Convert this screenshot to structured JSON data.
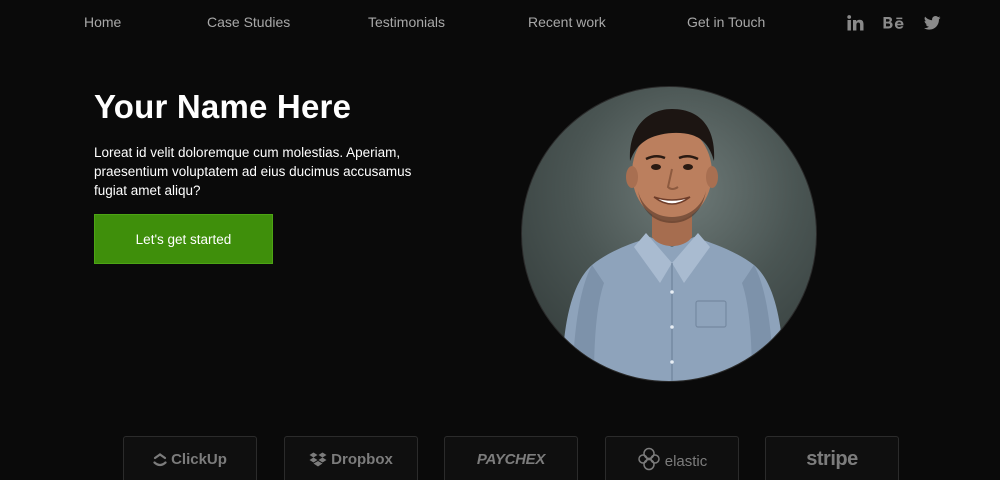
{
  "nav": {
    "links": [
      "Home",
      "Case Studies",
      "Testimonials",
      "Recent work",
      "Get in Touch"
    ],
    "social": [
      "linkedin-icon",
      "behance-icon",
      "twitter-icon"
    ]
  },
  "hero": {
    "title": "Your Name Here",
    "description": "Loreat id velit doloremque cum molestias. Aperiam, praesentium voluptatem ad eius ducimus accusamus fugiat amet aliqu?",
    "cta_label": "Let's get started"
  },
  "logos": [
    "ClickUp",
    "Dropbox",
    "PAYCHEX",
    "elastic",
    "stripe"
  ],
  "colors": {
    "background": "#0a0a0a",
    "accent": "#3f8f0b",
    "nav_text": "#a8a8a8",
    "logo_text": "#7c7c7c"
  }
}
